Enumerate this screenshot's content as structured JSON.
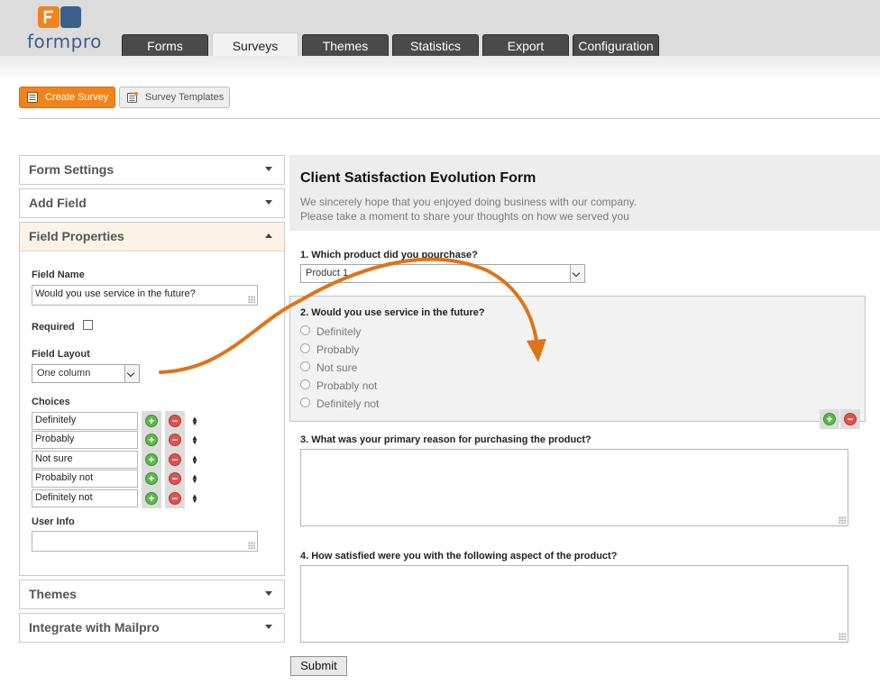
{
  "app": {
    "logo_text": "formpro",
    "brand_colors": {
      "orange": "#f0841a",
      "blue": "#3a5f8a"
    }
  },
  "nav": {
    "tabs": [
      {
        "label": "Forms"
      },
      {
        "label": "Surveys",
        "active": true
      },
      {
        "label": "Themes"
      },
      {
        "label": "Statistics"
      },
      {
        "label": "Export"
      },
      {
        "label": "Configuration"
      }
    ]
  },
  "toolbar": {
    "create_survey": "Create Survey",
    "survey_templates": "Survey Templates"
  },
  "sidebar": {
    "form_settings": "Form Settings",
    "add_field": "Add Field",
    "field_properties": "Field Properties",
    "themes": "Themes",
    "integrate": "Integrate with Mailpro",
    "properties": {
      "field_name_label": "Field Name",
      "field_name_value": "Would you use service in the future?",
      "required_label": "Required",
      "required_checked": false,
      "layout_label": "Field Layout",
      "layout_value": "One column",
      "choices_label": "Choices",
      "choices": [
        "Definitely",
        "Probably",
        "Not sure",
        "Probabily not",
        "Definitely not"
      ],
      "user_info_label": "User Info",
      "user_info_value": ""
    }
  },
  "form": {
    "title": "Client Satisfaction Evolution Form",
    "desc_line1": "We sincerely hope that you enjoyed doing business with our company.",
    "desc_line2": "Please take a moment to share your thoughts on how we served you",
    "q1": "1. Which product did you pourchase?",
    "q1_value": "Product 1",
    "q2": "2. Would you use service in the future?",
    "q2_options": [
      "Definitely",
      "Probably",
      "Not sure",
      "Probably not",
      "Definitely not"
    ],
    "q3": "3. What was your primary reason for purchasing the product?",
    "q4": "4. How satisfied were you with the following aspect of the product?",
    "submit": "Submit"
  }
}
